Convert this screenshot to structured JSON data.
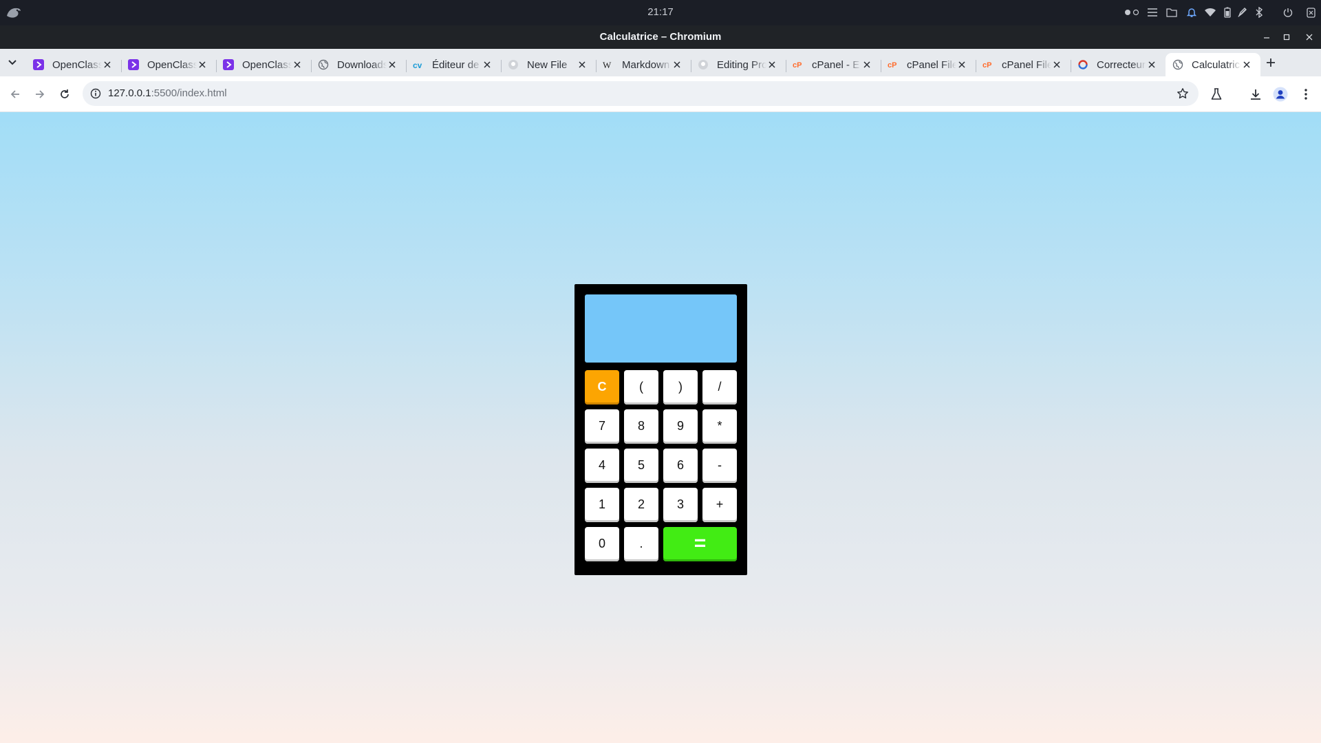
{
  "os": {
    "clock": "21:17",
    "tray_icons": [
      "workspace-dots-icon",
      "menu-lines-icon",
      "folder-icon",
      "bell-icon",
      "wifi-icon",
      "battery-icon",
      "pen-icon",
      "bluetooth-icon",
      "power-icon",
      "close-box-icon"
    ]
  },
  "window": {
    "title": "Calculatrice – Chromium"
  },
  "tabs": [
    {
      "label": "OpenClassrooms",
      "icon": "openclassrooms-icon",
      "color": "#7b32e8",
      "active": false
    },
    {
      "label": "OpenClassrooms",
      "icon": "openclassrooms-icon",
      "color": "#7b32e8",
      "active": false
    },
    {
      "label": "OpenClassrooms",
      "icon": "openclassrooms-icon",
      "color": "#7b32e8",
      "active": false
    },
    {
      "label": "Downloads",
      "icon": "globe-icon",
      "color": "#6b7078",
      "active": false
    },
    {
      "label": "Éditeur de CV",
      "icon": "cv-icon",
      "color": "#1a9bd6",
      "active": false
    },
    {
      "label": "New File",
      "icon": "github-icon",
      "color": "#d0d3d8",
      "active": false
    },
    {
      "label": "Markdown",
      "icon": "wikipedia-icon",
      "color": "#222222",
      "active": false
    },
    {
      "label": "Editing Project",
      "icon": "github-icon",
      "color": "#d0d3d8",
      "active": false
    },
    {
      "label": "cPanel - E",
      "icon": "cpanel-icon",
      "color": "#ff6c2c",
      "active": false
    },
    {
      "label": "cPanel File",
      "icon": "cpanel-icon",
      "color": "#ff6c2c",
      "active": false
    },
    {
      "label": "cPanel File",
      "icon": "cpanel-icon",
      "color": "#ff6c2c",
      "active": false
    },
    {
      "label": "Correcteur",
      "icon": "correcteur-icon",
      "color": "#d8392b",
      "active": false
    },
    {
      "label": "Calculatrice",
      "icon": "globe-icon",
      "color": "#6b7078",
      "active": true
    }
  ],
  "toolbar": {
    "url_host": "127.0.0.1",
    "url_path": ":5500/index.html"
  },
  "calculator": {
    "display_value": "",
    "keys": [
      {
        "label": "C",
        "kind": "clear"
      },
      {
        "label": "(",
        "kind": "op"
      },
      {
        "label": ")",
        "kind": "op"
      },
      {
        "label": "/",
        "kind": "op"
      },
      {
        "label": "7",
        "kind": "digit"
      },
      {
        "label": "8",
        "kind": "digit"
      },
      {
        "label": "9",
        "kind": "digit"
      },
      {
        "label": "*",
        "kind": "op"
      },
      {
        "label": "4",
        "kind": "digit"
      },
      {
        "label": "5",
        "kind": "digit"
      },
      {
        "label": "6",
        "kind": "digit"
      },
      {
        "label": "-",
        "kind": "op"
      },
      {
        "label": "1",
        "kind": "digit"
      },
      {
        "label": "2",
        "kind": "digit"
      },
      {
        "label": "3",
        "kind": "digit"
      },
      {
        "label": "+",
        "kind": "op"
      },
      {
        "label": "0",
        "kind": "digit"
      },
      {
        "label": ".",
        "kind": "op"
      },
      {
        "label": "=",
        "kind": "equals"
      }
    ],
    "colors": {
      "body": "#000000",
      "display": "#75c6f9",
      "clear": "#fca502",
      "equals": "#42ec14",
      "key": "#ffffff"
    }
  }
}
